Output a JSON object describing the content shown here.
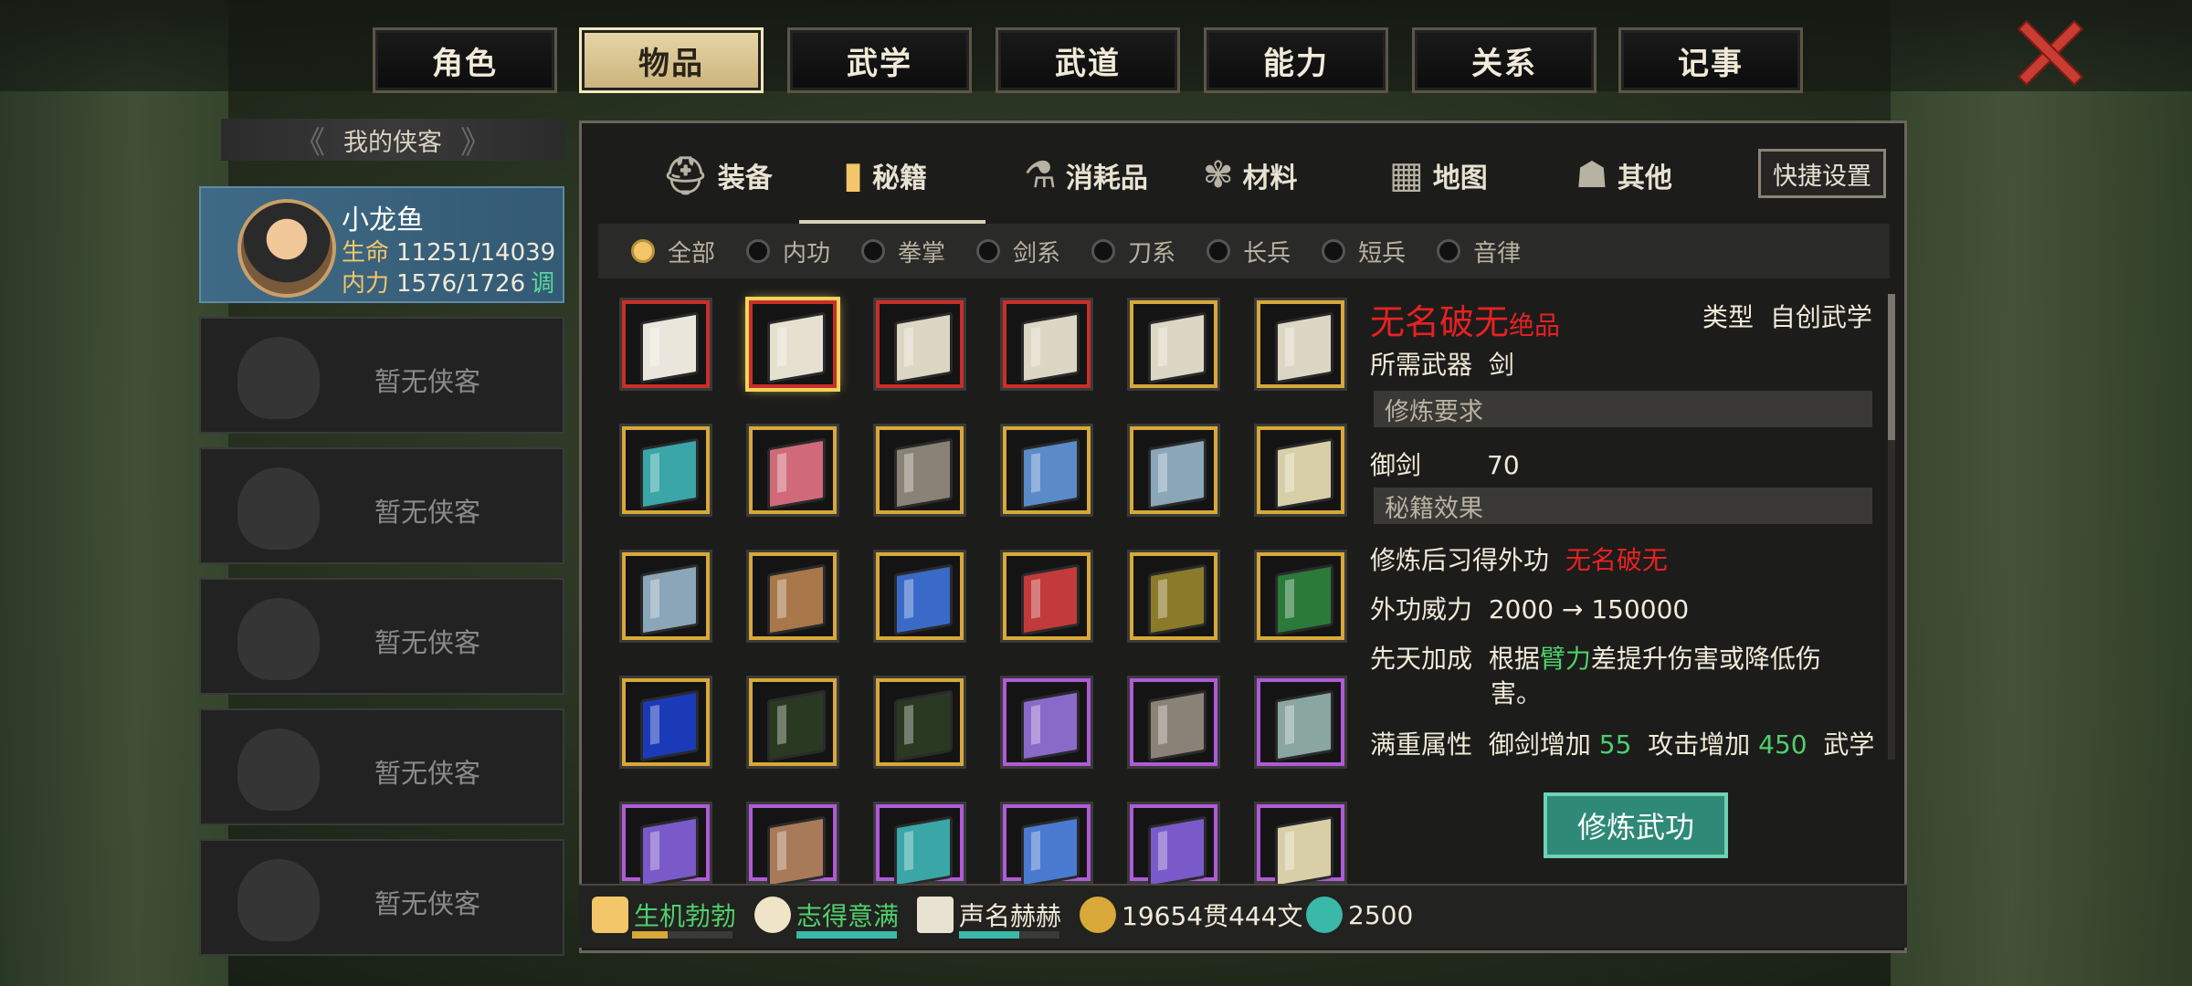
{
  "main_tabs": [
    "角色",
    "物品",
    "武学",
    "武道",
    "能力",
    "关系",
    "记事"
  ],
  "main_tab_active": 1,
  "hero_panel": {
    "header": "我的侠客",
    "active": {
      "name": "小龙鱼",
      "hp_label": "生命",
      "hp": "11251/14039",
      "mp_label": "内力",
      "mp": "1576/1726",
      "tune": "调"
    },
    "empty_label": "暂无侠客"
  },
  "categories": [
    "装备",
    "秘籍",
    "消耗品",
    "材料",
    "地图",
    "其他"
  ],
  "category_active": 1,
  "quick_settings": "快捷设置",
  "filters": [
    "全部",
    "内功",
    "拳掌",
    "剑系",
    "刀系",
    "长兵",
    "短兵",
    "音律"
  ],
  "filter_active": 0,
  "inventory": {
    "rows": [
      [
        {
          "rarity": "red",
          "color": "#eae6dc"
        },
        {
          "rarity": "red",
          "color": "#e6e0d0",
          "selected": true
        },
        {
          "rarity": "red",
          "color": "#dcd6c4"
        },
        {
          "rarity": "red",
          "color": "#dcd6c4"
        },
        {
          "rarity": "gold",
          "color": "#dcd6c4"
        },
        {
          "rarity": "gold",
          "color": "#dcd6c4"
        }
      ],
      [
        {
          "rarity": "gold",
          "color": "#3aa6a8"
        },
        {
          "rarity": "gold",
          "color": "#d06a7a"
        },
        {
          "rarity": "gold",
          "color": "#8a8276"
        },
        {
          "rarity": "gold",
          "color": "#5a8ac8"
        },
        {
          "rarity": "gold",
          "color": "#8aa6b8"
        },
        {
          "rarity": "gold",
          "color": "#d8cfa8"
        }
      ],
      [
        {
          "rarity": "gold",
          "color": "#8aa6b8"
        },
        {
          "rarity": "gold",
          "color": "#a8784a"
        },
        {
          "rarity": "gold",
          "color": "#3a6ac8"
        },
        {
          "rarity": "gold",
          "color": "#c23a3a"
        },
        {
          "rarity": "gold",
          "color": "#8a7a2a"
        },
        {
          "rarity": "gold",
          "color": "#2a7a3a"
        }
      ],
      [
        {
          "rarity": "gold",
          "color": "#1a3ab8"
        },
        {
          "rarity": "gold",
          "color": "#2a3a22"
        },
        {
          "rarity": "gold",
          "color": "#2a3a22"
        },
        {
          "rarity": "purple",
          "color": "#8a6ac8"
        },
        {
          "rarity": "purple",
          "color": "#8a8276"
        },
        {
          "rarity": "purple",
          "color": "#8aa6a0"
        }
      ],
      [
        {
          "rarity": "purple",
          "color": "#7a5ac8"
        },
        {
          "rarity": "purple",
          "color": "#a87a5a"
        },
        {
          "rarity": "purple",
          "color": "#3aa6a8"
        },
        {
          "rarity": "purple",
          "color": "#4a7ad0"
        },
        {
          "rarity": "purple",
          "color": "#7a5ac8"
        },
        {
          "rarity": "purple",
          "color": "#d8cfa8"
        }
      ]
    ]
  },
  "detail": {
    "name": "无名破无",
    "grade": "绝品",
    "type_label": "类型",
    "type": "自创武学",
    "weapon_label": "所需武器",
    "weapon": "剑",
    "req_section": "修炼要求",
    "req_name": "御剑",
    "req_value": "70",
    "effect_section": "秘籍效果",
    "learn_label": "修炼后习得外功",
    "learn_value": "无名破无",
    "power_label": "外功威力",
    "power_value": "2000 → 150000",
    "innate_label": "先天加成",
    "innate_pre": "根据",
    "innate_attr": "臂力",
    "innate_post": "差提升伤害或降低伤",
    "innate_line2": "害。",
    "full_label": "满重属性",
    "full_a": "御剑增加",
    "full_a_val": "55",
    "full_b": "攻击增加",
    "full_b_val": "450",
    "full_c": "武学"
  },
  "train_button": "修炼武功",
  "status": {
    "vitality": "生机勃勃",
    "vitality_fill": 0.35,
    "mood": "志得意满",
    "mood_fill": 1.0,
    "fame": "声名赫赫",
    "fame_fill": 0.6,
    "money": "19654贯444文",
    "gems": "2500"
  }
}
